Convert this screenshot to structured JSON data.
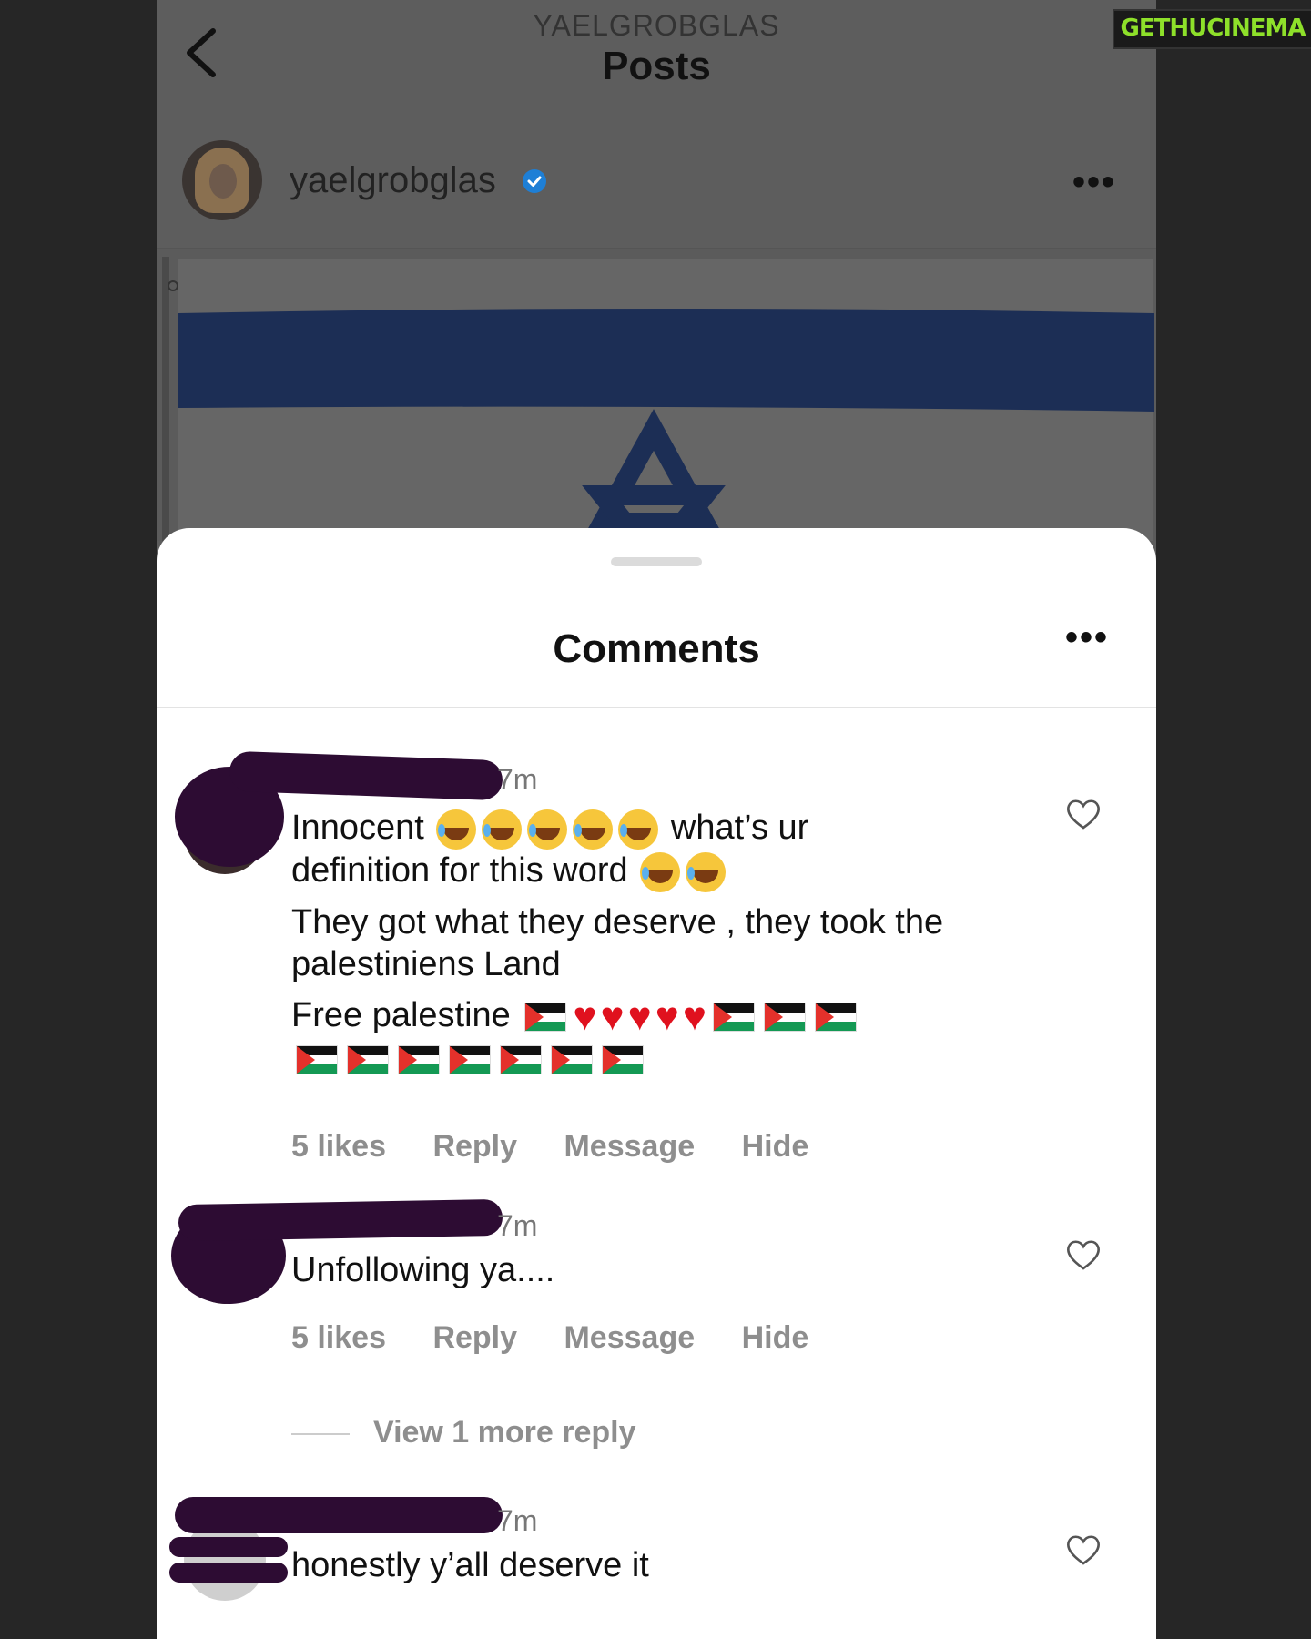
{
  "watermark": {
    "text": "GETHUCINEMA"
  },
  "header": {
    "account_handle": "YAELGROBGLAS",
    "title": "Posts",
    "back_icon": "chevron-left-icon"
  },
  "post": {
    "username": "yaelgrobglas",
    "verified": true,
    "more_icon": "ellipsis-icon",
    "more_label": "•••",
    "image": "israel-flag",
    "colors": {
      "flag_blue": "#1d3f8c",
      "flag_white": "#f2f2f2"
    }
  },
  "comments_sheet": {
    "title": "Comments",
    "more_label": "•••",
    "comments": [
      {
        "time": "7m",
        "lines": [
          "Innocent",
          "what’s ur",
          "definition for this word",
          "They got what they deserve , they took the",
          "palestiniens Land",
          "Free palestine"
        ],
        "likes": "5 likes",
        "reply": "Reply",
        "message": "Message",
        "hide": "Hide"
      },
      {
        "time": "7m",
        "text": "Unfollowing ya....",
        "likes": "5 likes",
        "reply": "Reply",
        "message": "Message",
        "hide": "Hide",
        "view_replies": "View 1 more reply"
      },
      {
        "time": "7m",
        "text": "honestly y’all deserve it"
      }
    ]
  }
}
